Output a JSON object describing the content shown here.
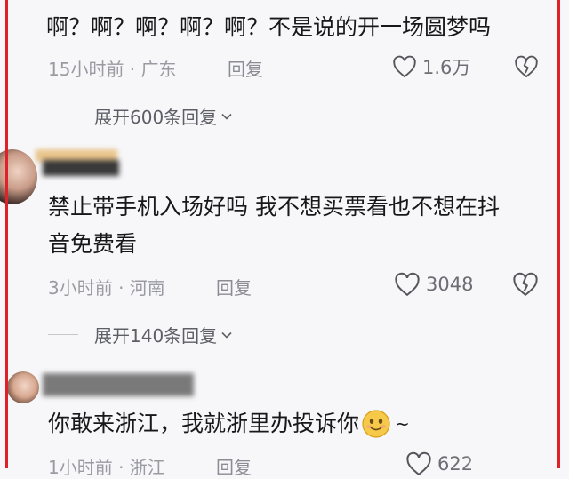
{
  "comments": [
    {
      "text": "啊？啊？啊？啊？啊？不是说的开一场圆梦吗",
      "time": "15小时前 · 广东",
      "reply_label": "回复",
      "likes": "1.6万",
      "expand_label": "展开600条回复"
    },
    {
      "text_line1": "禁止带手机入场好吗 我不想买票看也不想在抖",
      "text_line2": "音免费看",
      "time": "3小时前 · 河南",
      "reply_label": "回复",
      "likes": "3048",
      "expand_label": "展开140条回复"
    },
    {
      "text": "你敢来浙江，我就浙里办投诉你",
      "text_suffix": "~",
      "time": "1小时前 · 浙江",
      "reply_label": "回复",
      "likes": "622"
    }
  ],
  "colors": {
    "highlight_border": "#e0212a",
    "secondary_text": "#9a9aa2",
    "primary_text": "#17171c"
  }
}
